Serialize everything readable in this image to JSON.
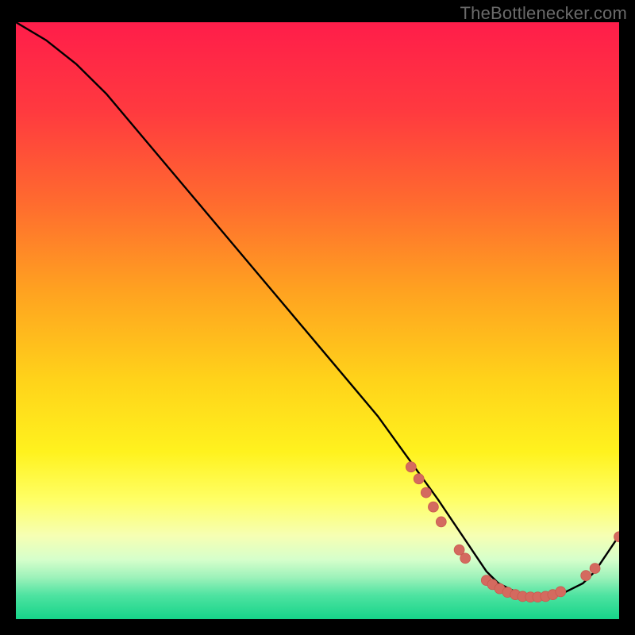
{
  "attribution": "TheBottlenecker.com",
  "colors": {
    "bg": "#000000",
    "curve_stroke": "#000000",
    "marker_fill": "#d46a5f",
    "marker_stroke": "#c95a4f",
    "attribution_text": "#6a6a6a"
  },
  "gradient_stops": [
    {
      "offset": 0.0,
      "color": "#ff1d4a"
    },
    {
      "offset": 0.15,
      "color": "#ff3a3f"
    },
    {
      "offset": 0.3,
      "color": "#ff6a2f"
    },
    {
      "offset": 0.45,
      "color": "#ffa220"
    },
    {
      "offset": 0.6,
      "color": "#ffd31a"
    },
    {
      "offset": 0.72,
      "color": "#fff21e"
    },
    {
      "offset": 0.8,
      "color": "#ffff66"
    },
    {
      "offset": 0.86,
      "color": "#f6ffb3"
    },
    {
      "offset": 0.9,
      "color": "#d6ffcb"
    },
    {
      "offset": 0.93,
      "color": "#9df2ba"
    },
    {
      "offset": 0.96,
      "color": "#4ee3a1"
    },
    {
      "offset": 1.0,
      "color": "#16d489"
    }
  ],
  "chart_data": {
    "type": "line",
    "title": "",
    "xlabel": "",
    "ylabel": "",
    "xlim": [
      0,
      100
    ],
    "ylim": [
      0,
      100
    ],
    "series": [
      {
        "name": "bottleneck-curve",
        "x": [
          0,
          5,
          10,
          15,
          20,
          25,
          30,
          35,
          40,
          45,
          50,
          55,
          60,
          65,
          70,
          72,
          74,
          76,
          78,
          80,
          82,
          84,
          86,
          88,
          90,
          92,
          94,
          96,
          98,
          100
        ],
        "values": [
          100,
          97,
          93,
          88,
          82,
          76,
          70,
          64,
          58,
          52,
          46,
          40,
          34,
          27,
          20,
          17,
          14,
          11,
          8,
          6,
          5,
          4,
          4,
          4,
          4,
          5,
          6,
          8,
          11,
          14
        ]
      }
    ],
    "markers": [
      {
        "x": 65.5,
        "y": 25.5
      },
      {
        "x": 66.8,
        "y": 23.5
      },
      {
        "x": 68.0,
        "y": 21.2
      },
      {
        "x": 69.2,
        "y": 18.8
      },
      {
        "x": 70.5,
        "y": 16.3
      },
      {
        "x": 73.5,
        "y": 11.6
      },
      {
        "x": 74.5,
        "y": 10.2
      },
      {
        "x": 78.0,
        "y": 6.5
      },
      {
        "x": 79.0,
        "y": 5.8
      },
      {
        "x": 80.2,
        "y": 5.1
      },
      {
        "x": 81.5,
        "y": 4.5
      },
      {
        "x": 82.8,
        "y": 4.1
      },
      {
        "x": 84.0,
        "y": 3.8
      },
      {
        "x": 85.3,
        "y": 3.7
      },
      {
        "x": 86.5,
        "y": 3.7
      },
      {
        "x": 87.8,
        "y": 3.8
      },
      {
        "x": 89.0,
        "y": 4.1
      },
      {
        "x": 90.3,
        "y": 4.6
      },
      {
        "x": 94.5,
        "y": 7.3
      },
      {
        "x": 96.0,
        "y": 8.5
      },
      {
        "x": 100.0,
        "y": 13.8
      }
    ],
    "marker_radius_data_units": 0.85
  }
}
